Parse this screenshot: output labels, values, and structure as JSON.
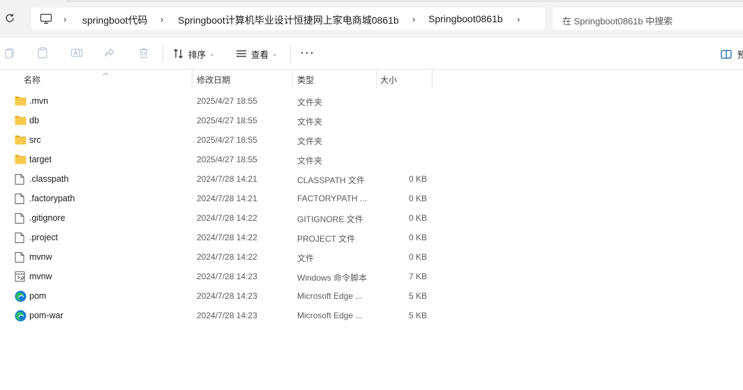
{
  "address": {
    "crumbs": [
      "springboot代码",
      "Springboot计算机毕业设计恒捷网上家电商城0861b",
      "Springboot0861b"
    ],
    "search_placeholder": "在 Springboot0861b 中搜索"
  },
  "toolbar": {
    "sort_label": "排序",
    "view_label": "查看",
    "more_label": "···",
    "preview_label": "预"
  },
  "columns": {
    "name": "名称",
    "modified": "修改日期",
    "type": "类型",
    "size": "大小"
  },
  "files": [
    {
      "name": ".mvn",
      "date": "2025/4/27 18:55",
      "type": "文件夹",
      "size": "",
      "icon": "folder-icon"
    },
    {
      "name": "db",
      "date": "2025/4/27 18:55",
      "type": "文件夹",
      "size": "",
      "icon": "folder-icon"
    },
    {
      "name": "src",
      "date": "2025/4/27 18:55",
      "type": "文件夹",
      "size": "",
      "icon": "folder-icon"
    },
    {
      "name": "target",
      "date": "2025/4/27 18:55",
      "type": "文件夹",
      "size": "",
      "icon": "folder-icon"
    },
    {
      "name": ".classpath",
      "date": "2024/7/28 14:21",
      "type": "CLASSPATH 文件",
      "size": "0 KB",
      "icon": "file-icon"
    },
    {
      "name": ".factorypath",
      "date": "2024/7/28 14:21",
      "type": "FACTORYPATH ...",
      "size": "0 KB",
      "icon": "file-icon"
    },
    {
      "name": ".gitignore",
      "date": "2024/7/28 14:22",
      "type": "GITIGNORE 文件",
      "size": "0 KB",
      "icon": "file-icon"
    },
    {
      "name": ".project",
      "date": "2024/7/28 14:22",
      "type": "PROJECT 文件",
      "size": "0 KB",
      "icon": "file-icon"
    },
    {
      "name": "mvnw",
      "date": "2024/7/28 14:22",
      "type": "文件",
      "size": "0 KB",
      "icon": "file-icon"
    },
    {
      "name": "mvnw",
      "date": "2024/7/28 14:23",
      "type": "Windows 命令脚本",
      "size": "7 KB",
      "icon": "script-icon"
    },
    {
      "name": "pom",
      "date": "2024/7/28 14:23",
      "type": "Microsoft Edge ...",
      "size": "5 KB",
      "icon": "edge-icon"
    },
    {
      "name": "pom-war",
      "date": "2024/7/28 14:23",
      "type": "Microsoft Edge ...",
      "size": "5 KB",
      "icon": "edge-icon"
    }
  ],
  "colors": {
    "folder": "#f8c94d",
    "folder_dark": "#e8a820",
    "edge_blue": "#0f79d7",
    "edge_green": "#34c759"
  }
}
